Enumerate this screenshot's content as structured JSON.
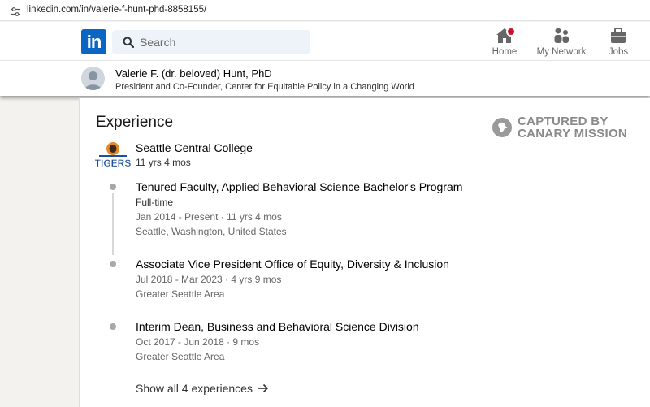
{
  "browser": {
    "url": "linkedin.com/in/valerie-f-hunt-phd-8858155/"
  },
  "nav": {
    "logo": "in",
    "search_placeholder": "Search",
    "items": [
      {
        "label": "Home",
        "icon": "home-icon"
      },
      {
        "label": "My Network",
        "icon": "network-icon"
      },
      {
        "label": "Jobs",
        "icon": "briefcase-icon"
      }
    ]
  },
  "profile": {
    "name": "Valerie F. (dr. beloved) Hunt, PhD",
    "headline": "President and Co-Founder, Center for Equitable Policy in a Changing World"
  },
  "experience": {
    "title": "Experience",
    "watermark": [
      "CAPTURED BY",
      "CANARY MISSION"
    ],
    "org": {
      "name": "Seattle Central College",
      "duration": "11 yrs 4 mos",
      "logo_text": "TIGERS"
    },
    "roles": [
      {
        "title": "Tenured Faculty, Applied Behavioral Science Bachelor's Program",
        "type": "Full-time",
        "dates": "Jan 2014 - Present · 11 yrs 4 mos",
        "location": "Seattle, Washington, United States"
      },
      {
        "title": "Associate Vice President Office of Equity, Diversity & Inclusion",
        "dates": "Jul 2018 - Mar 2023 · 4 yrs 9 mos",
        "location": "Greater Seattle Area"
      },
      {
        "title": "Interim Dean, Business and Behavioral Science Division",
        "dates": "Oct 2017 - Jun 2018 · 9 mos",
        "location": "Greater Seattle Area"
      }
    ],
    "show_all": "Show all 4 experiences"
  },
  "colors": {
    "brand": "#0a66c2",
    "notification": "#cb112d",
    "search_bg": "#edf3f8",
    "page_bg": "#f4f2ee"
  }
}
